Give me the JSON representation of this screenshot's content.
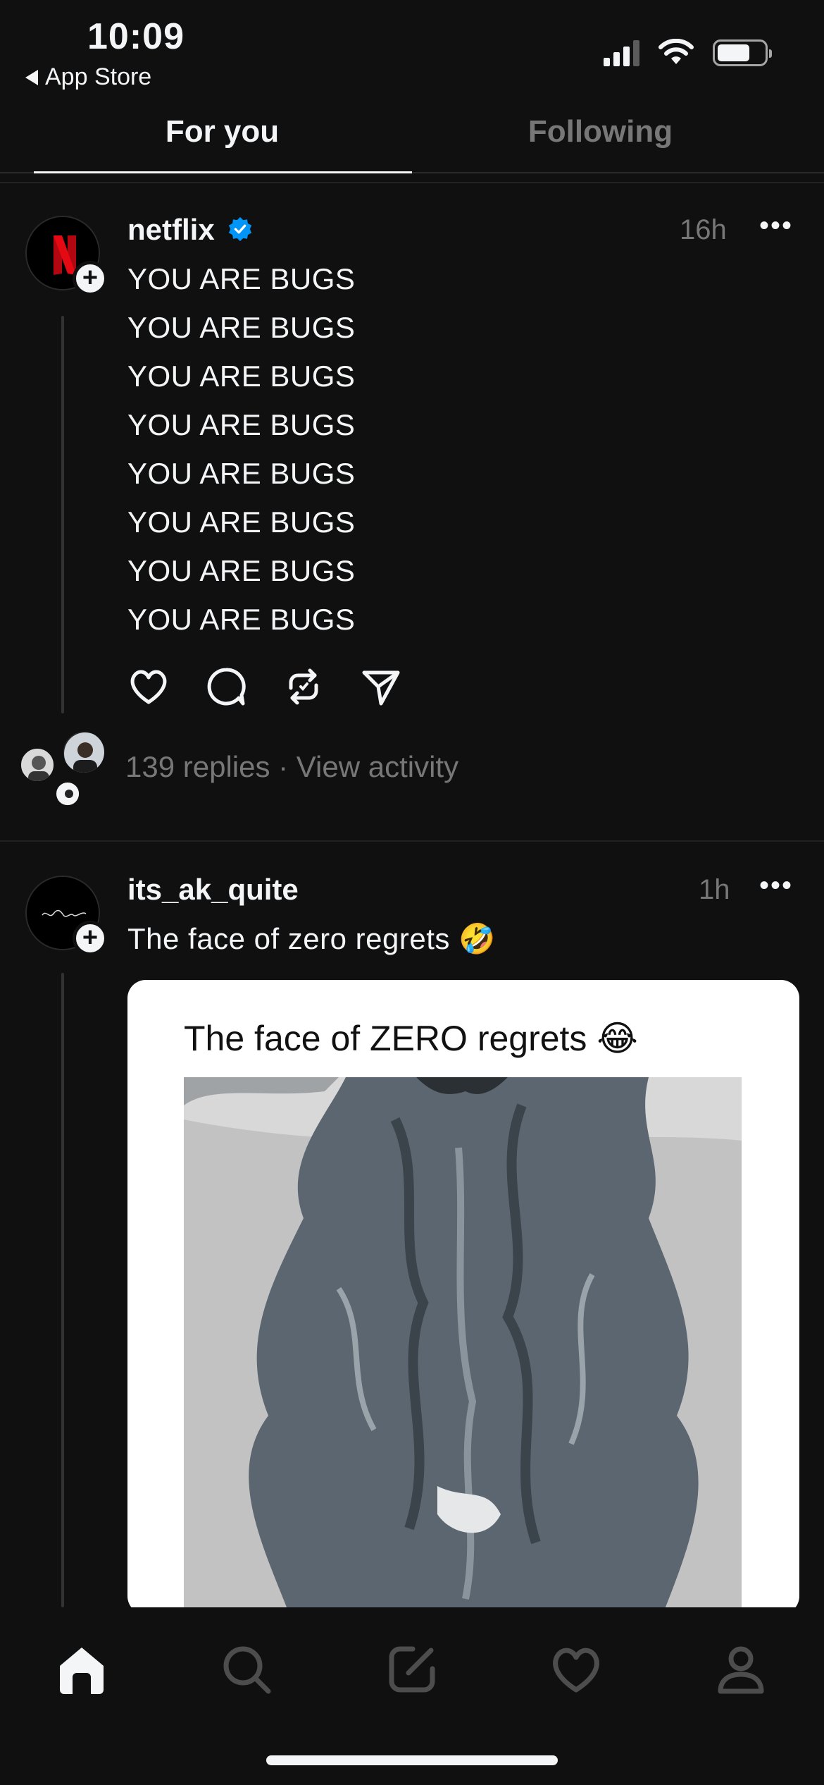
{
  "status_bar": {
    "time": "10:09",
    "back_label": "App Store"
  },
  "tabs": [
    {
      "label": "For you"
    },
    {
      "label": "Following"
    }
  ],
  "posts": [
    {
      "username": "netflix",
      "verified": true,
      "time": "16h",
      "lines": [
        "YOU ARE BUGS",
        "YOU ARE BUGS",
        "YOU ARE BUGS",
        "YOU ARE BUGS",
        "YOU ARE BUGS",
        "YOU ARE BUGS",
        "YOU ARE BUGS",
        "YOU ARE BUGS"
      ],
      "avatar_letter": "N",
      "replies_text": "139 replies",
      "separator": " · ",
      "activity_text": "View activity"
    },
    {
      "username": "its_ak_quite",
      "verified": false,
      "time": "1h",
      "text": "The face of zero regrets 🤣",
      "card_title": "The face of ZERO regrets 😂"
    }
  ],
  "colors": {
    "background": "#101010",
    "text": "#f3f5f7",
    "muted": "#777777",
    "verified_blue": "#0095f6",
    "netflix_red": "#e50914"
  },
  "icons": [
    "heart-icon",
    "comment-icon",
    "repost-icon",
    "share-icon",
    "home-icon",
    "search-icon",
    "compose-icon",
    "activity-heart-icon",
    "profile-icon"
  ]
}
